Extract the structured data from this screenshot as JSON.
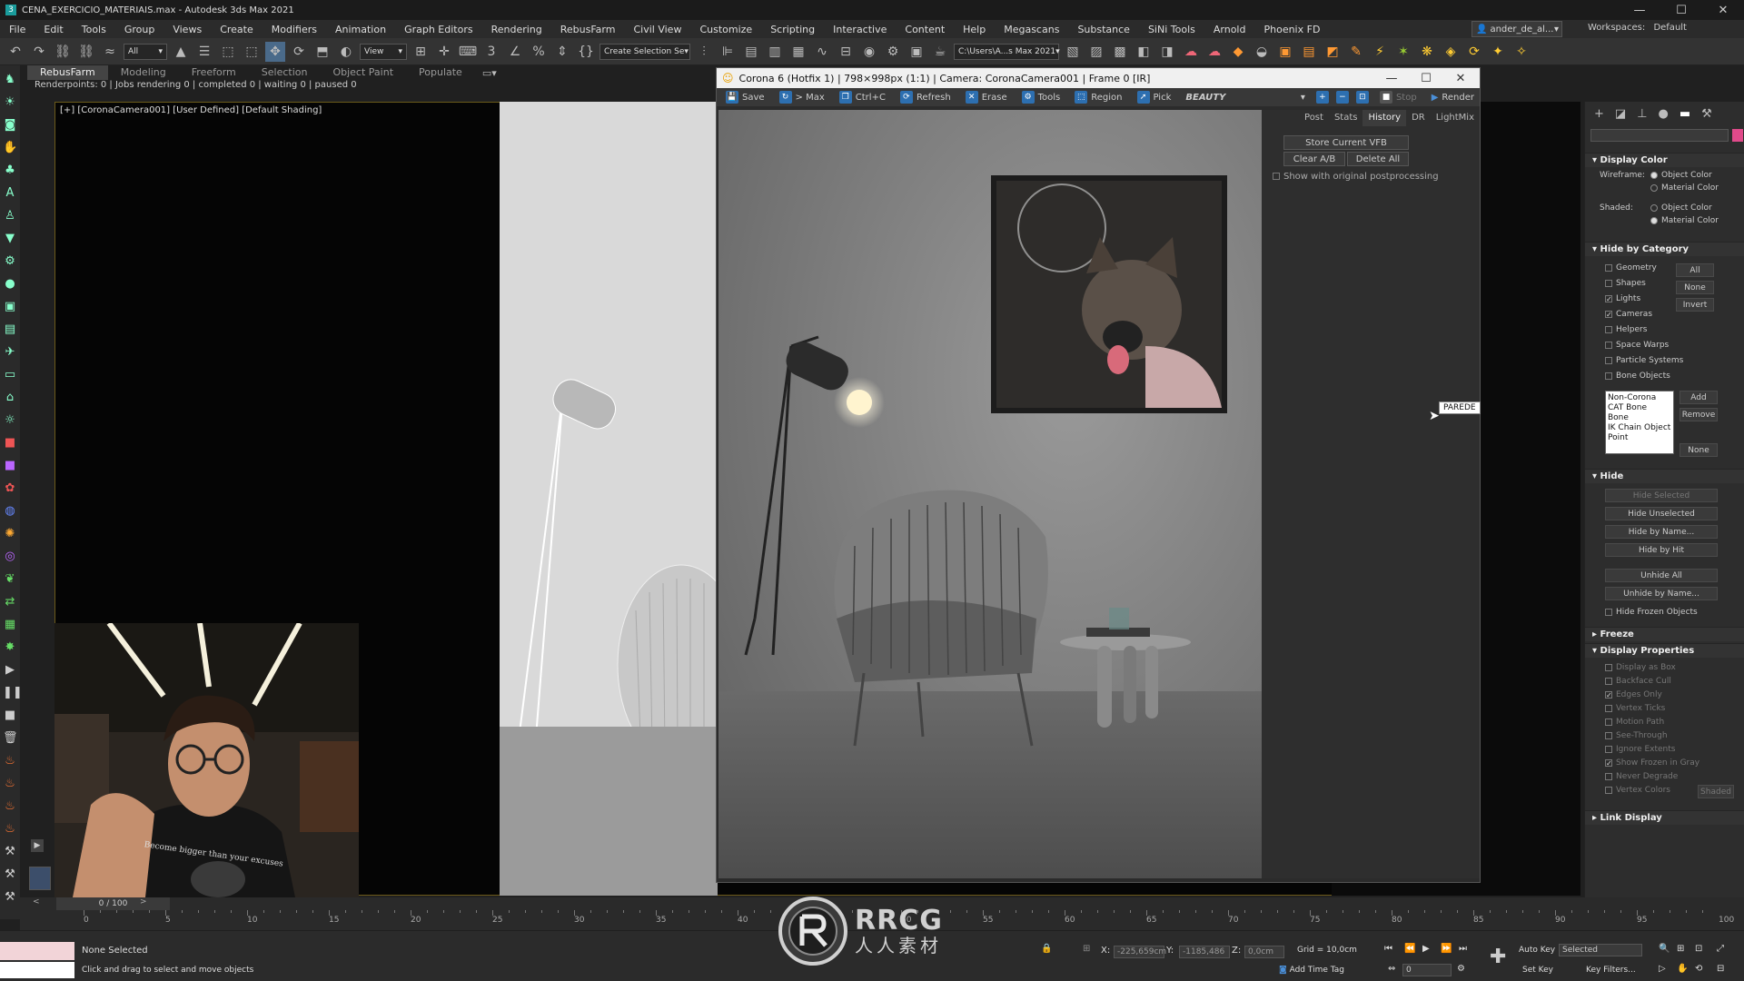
{
  "window": {
    "title": "CENA_EXERCICIO_MATERIAIS.max - Autodesk 3ds Max 2021"
  },
  "menu": [
    "File",
    "Edit",
    "Tools",
    "Group",
    "Views",
    "Create",
    "Modifiers",
    "Animation",
    "Graph Editors",
    "Rendering",
    "RebusFarm",
    "Civil View",
    "Customize",
    "Scripting",
    "Interactive",
    "Content",
    "Help",
    "Megascans",
    "Substance",
    "SiNi Tools",
    "Arnold",
    "Phoenix FD"
  ],
  "user": {
    "name": "ander_de_al...",
    "workspaces_label": "Workspaces:",
    "workspace": "Default"
  },
  "toolbar": {
    "filter": "All",
    "view": "View",
    "selection_set": "Create Selection Se",
    "project_path": "C:\\Users\\A...s Max 2021"
  },
  "ribbon_tabs": [
    "RebusFarm",
    "Modeling",
    "Freeform",
    "Selection",
    "Object Paint",
    "Populate"
  ],
  "renderpoints": "Renderpoints: 0 | Jobs rendering 0 | completed 0 | waiting 0 | paused 0",
  "viewport": {
    "label": "[+] [CoronaCamera001] [User Defined] [Default Shading]"
  },
  "vfb": {
    "title": "Corona 6 (Hotfix 1) | 798×998px (1:1) | Camera: CoronaCamera001 | Frame 0 [IR]",
    "buttons": {
      "save": "Save",
      "to_max": "> Max",
      "copy": "Ctrl+C",
      "refresh": "Refresh",
      "erase": "Erase",
      "tools": "Tools",
      "region": "Region",
      "pick": "Pick",
      "pass": "BEAUTY",
      "stop": "Stop",
      "render": "Render"
    },
    "tabs": [
      "Post",
      "Stats",
      "History",
      "DR",
      "LightMix"
    ],
    "active_tab": "History",
    "history": {
      "store": "Store Current VFB",
      "clear": "Clear A/B",
      "delete_all": "Delete All",
      "show_orig": "Show with original postprocessing"
    },
    "tooltip": "PAREDE"
  },
  "cmd": {
    "display_color": {
      "title": "Display Color",
      "wireframe": "Wireframe:",
      "shaded": "Shaded:",
      "object_color": "Object Color",
      "material_color": "Material Color"
    },
    "hide_by_category": {
      "title": "Hide by Category",
      "items": [
        {
          "label": "Geometry",
          "checked": false
        },
        {
          "label": "Shapes",
          "checked": false
        },
        {
          "label": "Lights",
          "checked": true
        },
        {
          "label": "Cameras",
          "checked": true
        },
        {
          "label": "Helpers",
          "checked": false
        },
        {
          "label": "Space Warps",
          "checked": false
        },
        {
          "label": "Particle Systems",
          "checked": false
        },
        {
          "label": "Bone Objects",
          "checked": false
        }
      ],
      "all": "All",
      "none": "None",
      "invert": "Invert",
      "list": [
        "Non-Corona",
        "CAT Bone",
        "Bone",
        "IK Chain Object",
        "Point"
      ],
      "add": "Add",
      "remove": "Remove",
      "none2": "None"
    },
    "hide": {
      "title": "Hide",
      "selected": "Hide Selected",
      "unselected": "Hide Unselected",
      "by_name": "Hide by Name...",
      "by_hit": "Hide by Hit",
      "unhide_all": "Unhide All",
      "unhide_by_name": "Unhide by Name...",
      "frozen": "Hide Frozen Objects"
    },
    "freeze": {
      "title": "Freeze"
    },
    "display_properties": {
      "title": "Display Properties",
      "items": [
        {
          "label": "Display as Box",
          "checked": false
        },
        {
          "label": "Backface Cull",
          "checked": false
        },
        {
          "label": "Edges Only",
          "checked": true
        },
        {
          "label": "Vertex Ticks",
          "checked": false
        },
        {
          "label": "Motion Path",
          "checked": false
        },
        {
          "label": "See-Through",
          "checked": false
        },
        {
          "label": "Ignore Extents",
          "checked": false
        },
        {
          "label": "Show Frozen in Gray",
          "checked": true
        },
        {
          "label": "Never Degrade",
          "checked": false
        },
        {
          "label": "Vertex Colors",
          "checked": false
        }
      ],
      "shaded": "Shaded"
    },
    "link_display": {
      "title": "Link Display"
    }
  },
  "timeline": {
    "frame": "0 / 100",
    "ticks": [
      "0",
      "5",
      "10",
      "15",
      "20",
      "25",
      "30",
      "35",
      "40",
      "45",
      "50",
      "55",
      "60",
      "65",
      "70",
      "75",
      "80",
      "85",
      "90",
      "95",
      "100"
    ]
  },
  "status": {
    "selection": "None Selected",
    "prompt": "Click and drag to select and move objects",
    "x_label": "X:",
    "x": "-225,659cm",
    "y_label": "Y:",
    "y": "-1185,486",
    "z_label": "Z:",
    "z": "0,0cm",
    "grid": "Grid = 10,0cm",
    "add_time_tag": "Add Time Tag",
    "auto_key": "Auto Key",
    "set_key": "Set Key",
    "selected": "Selected",
    "key_filters": "Key Filters...",
    "frame_field": "0"
  },
  "watermark": {
    "line1": "RRCG",
    "line2": "人人素材"
  },
  "colors": {
    "accent": "#4a8fd8",
    "viewport_border": "#6b5a1a"
  }
}
